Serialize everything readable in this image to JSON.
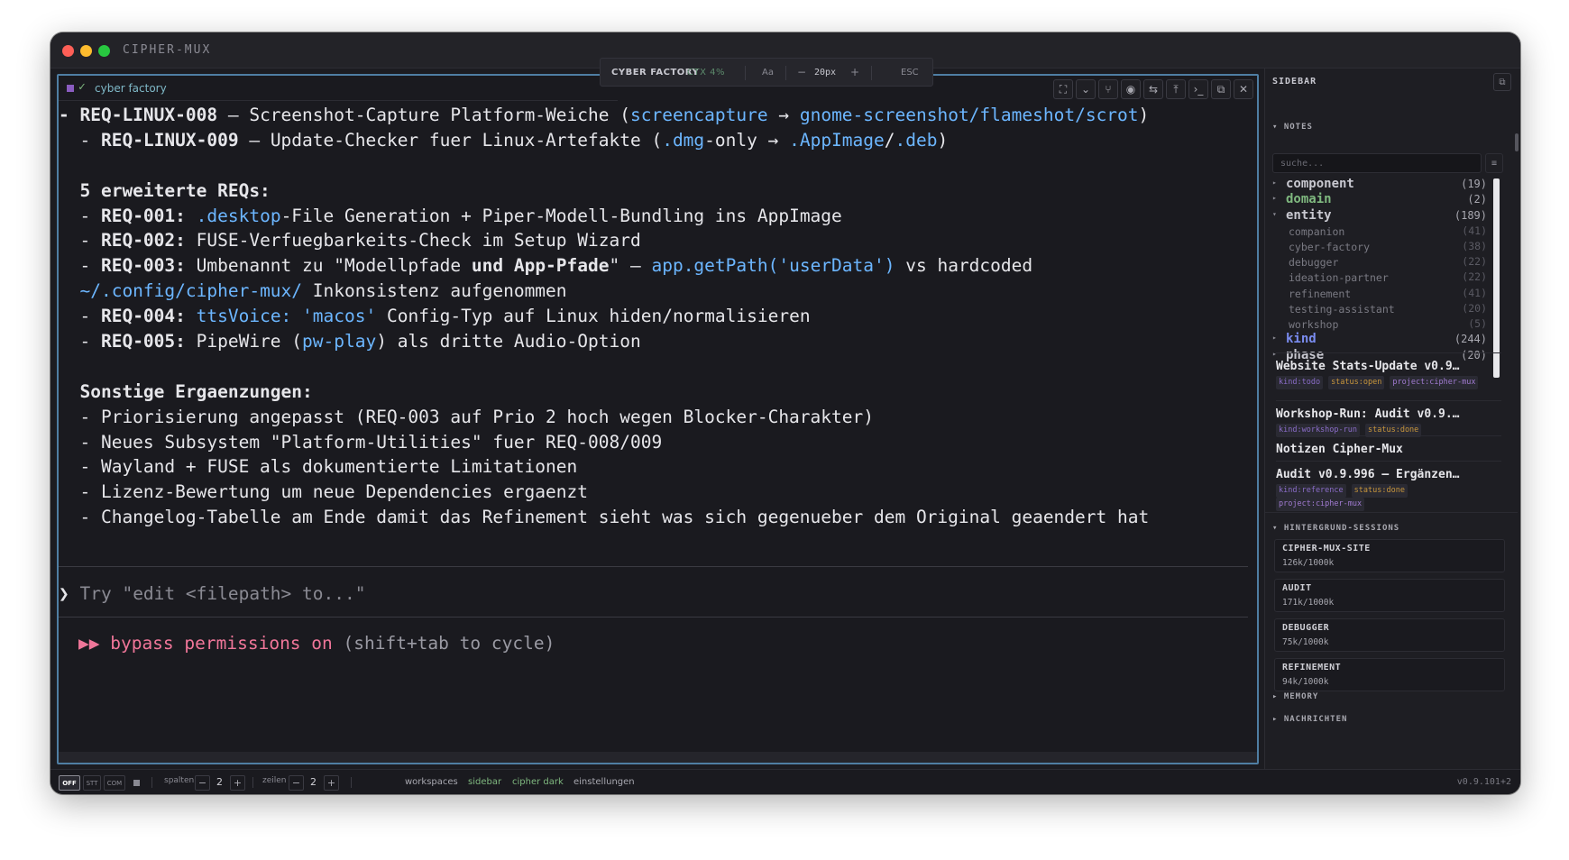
{
  "app": {
    "title": "CIPHER-MUX"
  },
  "pane": {
    "tab_name": "cyber factory",
    "floatbar": {
      "title": "CYBER FACTORY",
      "ctx": "CTX 4%",
      "font_btn": "Aa",
      "minus": "−",
      "size": "20px",
      "plus": "+",
      "esc": "ESC"
    },
    "tools": [
      "fullscreen-icon",
      "chevron-down-icon",
      "git-branch-icon",
      "camera-icon",
      "swap-icon",
      "upload-icon",
      "terminal-icon",
      "external-link-icon",
      "close-icon"
    ],
    "tool_glyphs": [
      "⛶",
      "⌄",
      "⑂",
      "◉",
      "⇆",
      "⤒",
      "›_",
      "⧉",
      "✕"
    ]
  },
  "terminal": {
    "lines": [
      [
        {
          "t": "- ",
          "s": "b"
        },
        {
          "t": "REQ-LINUX-008",
          "s": "b"
        },
        {
          "t": " — Screenshot-Capture Platform-Weiche ("
        },
        {
          "t": "screencapture",
          "s": "c"
        },
        {
          "t": " → "
        },
        {
          "t": "gnome-screenshot/flameshot/scrot",
          "s": "c"
        },
        {
          "t": ")"
        }
      ],
      [
        {
          "t": "  - "
        },
        {
          "t": "REQ-LINUX-009",
          "s": "b"
        },
        {
          "t": " — Update-Checker fuer Linux-Artefakte ("
        },
        {
          "t": ".dmg",
          "s": "c"
        },
        {
          "t": "-only → "
        },
        {
          "t": ".AppImage",
          "s": "c"
        },
        {
          "t": "/"
        },
        {
          "t": ".deb",
          "s": "c"
        },
        {
          "t": ")"
        }
      ],
      [],
      [
        {
          "t": "  5 erweiterte REQs:",
          "s": "b"
        }
      ],
      [
        {
          "t": "  - "
        },
        {
          "t": "REQ-001:",
          "s": "b"
        },
        {
          "t": " "
        },
        {
          "t": ".desktop",
          "s": "c"
        },
        {
          "t": "-File Generation + Piper-Modell-Bundling ins AppImage"
        }
      ],
      [
        {
          "t": "  - "
        },
        {
          "t": "REQ-002:",
          "s": "b"
        },
        {
          "t": " FUSE-Verfuegbarkeits-Check im Setup Wizard"
        }
      ],
      [
        {
          "t": "  - "
        },
        {
          "t": "REQ-003:",
          "s": "b"
        },
        {
          "t": " Umbenannt zu \"Modellpfade "
        },
        {
          "t": "und App-Pfade",
          "s": "b"
        },
        {
          "t": "\" — "
        },
        {
          "t": "app.getPath('userData')",
          "s": "c"
        },
        {
          "t": " vs hardcoded"
        }
      ],
      [
        {
          "t": "  "
        },
        {
          "t": "~/.config/cipher-mux/",
          "s": "c"
        },
        {
          "t": " Inkonsistenz aufgenommen"
        }
      ],
      [
        {
          "t": "  - "
        },
        {
          "t": "REQ-004:",
          "s": "b"
        },
        {
          "t": " "
        },
        {
          "t": "ttsVoice: 'macos'",
          "s": "c"
        },
        {
          "t": " Config-Typ auf Linux hiden/normalisieren"
        }
      ],
      [
        {
          "t": "  - "
        },
        {
          "t": "REQ-005:",
          "s": "b"
        },
        {
          "t": " PipeWire ("
        },
        {
          "t": "pw-play",
          "s": "c"
        },
        {
          "t": ") als dritte Audio-Option"
        }
      ],
      [],
      [
        {
          "t": "  Sonstige Ergaenzungen:",
          "s": "b"
        }
      ],
      [
        {
          "t": "  - Priorisierung angepasst (REQ-003 auf Prio 2 hoch wegen Blocker-Charakter)"
        }
      ],
      [
        {
          "t": "  - Neues Subsystem \"Platform-Utilities\" fuer REQ-008/009"
        }
      ],
      [
        {
          "t": "  - Wayland + FUSE als dokumentierte Limitationen"
        }
      ],
      [
        {
          "t": "  - Lizenz-Bewertung um neue Dependencies ergaenzt"
        }
      ],
      [
        {
          "t": "  - Changelog-Tabelle am Ende damit das Refinement sieht was sich gegenueber dem Original geaendert hat"
        }
      ]
    ],
    "prompt_symbol": "❯",
    "prompt_placeholder": " Try \"edit <filepath> to...\"",
    "perm_arrows": "▶▶",
    "perm_text": " bypass permissions on",
    "perm_hint": " (shift+tab to cycle)"
  },
  "sidebar": {
    "title": "SIDEBAR",
    "notes_label": "▾ NOTES",
    "search_placeholder": "suche...",
    "tree": [
      {
        "label": "component",
        "count": "(19)",
        "color": "#c8c8d0",
        "arrow": "▸"
      },
      {
        "label": "domain",
        "count": "(2)",
        "color": "#7fb87f",
        "arrow": "▸"
      },
      {
        "label": "entity",
        "count": "(189)",
        "color": "#c8c8d0",
        "arrow": "▾"
      },
      {
        "label": "companion",
        "count": "(41)",
        "sub": true
      },
      {
        "label": "cyber-factory",
        "count": "(38)",
        "sub": true
      },
      {
        "label": "debugger",
        "count": "(22)",
        "sub": true
      },
      {
        "label": "ideation-partner",
        "count": "(22)",
        "sub": true
      },
      {
        "label": "refinement",
        "count": "(41)",
        "sub": true
      },
      {
        "label": "testing-assistant",
        "count": "(20)",
        "sub": true
      },
      {
        "label": "workshop",
        "count": "(5)",
        "sub": true
      },
      {
        "label": "kind",
        "count": "(244)",
        "color": "#7a8cf0",
        "arrow": "▸"
      },
      {
        "label": "phase",
        "count": "(20)",
        "color": "#c8c8d0",
        "arrow": "▸"
      }
    ],
    "cards": [
      {
        "title": "Website Stats-Update v0.9…",
        "tags": [
          {
            "t": "kind:todo",
            "c": "purple"
          },
          {
            "t": "status:open",
            "c": "orange"
          },
          {
            "t": "project:cipher-mux",
            "c": "violet"
          }
        ]
      },
      {
        "title": "Workshop-Run: Audit v0.9.…",
        "tags": [
          {
            "t": "kind:workshop-run",
            "c": "purple"
          },
          {
            "t": "status:done",
            "c": "orange"
          }
        ]
      },
      {
        "title": "Notizen Cipher-Mux",
        "tags": []
      },
      {
        "title": "Audit v0.9.996 — Ergänzen…",
        "tags": [
          {
            "t": "kind:reference",
            "c": "purple"
          },
          {
            "t": "status:done",
            "c": "orange"
          },
          {
            "t": "project:cipher-mux",
            "c": "violet"
          }
        ]
      }
    ],
    "sessions_label": "▾ HINTERGRUND-SESSIONS",
    "sessions": [
      {
        "name": "CIPHER-MUX-SITE",
        "stats": "126k/1000k"
      },
      {
        "name": "AUDIT",
        "stats": "171k/1000k"
      },
      {
        "name": "DEBUGGER",
        "stats": "75k/1000k"
      },
      {
        "name": "REFINEMENT",
        "stats": "94k/1000k"
      }
    ],
    "memory_label": "▸ MEMORY",
    "messages_label": "▸ NACHRICHTEN"
  },
  "statusbar": {
    "modes": [
      "OFF",
      "STT",
      "COM"
    ],
    "cols_label": "spalten",
    "cols_value": "2",
    "rows_label": "zeilen",
    "rows_value": "2",
    "minus": "−",
    "plus": "+",
    "links": [
      "workspaces",
      "sidebar",
      "cipher dark",
      "einstellungen"
    ],
    "version": "v0.9.101+2"
  }
}
